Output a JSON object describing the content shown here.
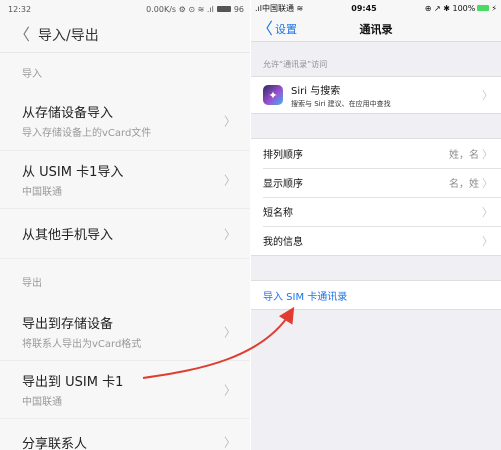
{
  "left": {
    "status": {
      "time": "12:32",
      "info": "0.00K/s ⚙ ⊙ ≋ .ıl",
      "battery": "96"
    },
    "topbar": {
      "back": "〈",
      "title": "导入/导出"
    },
    "sections": {
      "import": "导入",
      "export": "导出"
    },
    "rows": [
      {
        "title": "从存储设备导入",
        "sub": "导入存储设备上的vCard文件"
      },
      {
        "title": "从 USIM 卡1导入",
        "sub": "中国联通"
      },
      {
        "title": "从其他手机导入",
        "sub": ""
      },
      {
        "title": "导出到存储设备",
        "sub": "将联系人导出为vCard格式"
      },
      {
        "title": "导出到 USIM 卡1",
        "sub": "中国联通"
      },
      {
        "title": "分享联系人",
        "sub": ""
      }
    ],
    "chevron": "〉"
  },
  "right": {
    "status": {
      "carrier": ".ıl中国联通 ≋",
      "time": "09:45",
      "right": "⊕ ↗ ✱ 100%",
      "bolt": "⚡"
    },
    "navbar": {
      "back_chev": "〈",
      "back_label": "设置",
      "title": "通讯录"
    },
    "caption": "允许“通讯录”访问",
    "siri": {
      "title": "Siri 与搜索",
      "subtitle": "搜索与 Siri 建议、在应用中查找"
    },
    "settings": [
      {
        "label": "排列顺序",
        "value": "姓，名"
      },
      {
        "label": "显示顺序",
        "value": "名，姓"
      },
      {
        "label": "短名称",
        "value": ""
      },
      {
        "label": "我的信息",
        "value": ""
      }
    ],
    "import_sim": "导入 SIM 卡通讯录",
    "chevron": "〉"
  },
  "colors": {
    "ios_blue": "#1a73e8",
    "arrow_red": "#e03c31"
  }
}
